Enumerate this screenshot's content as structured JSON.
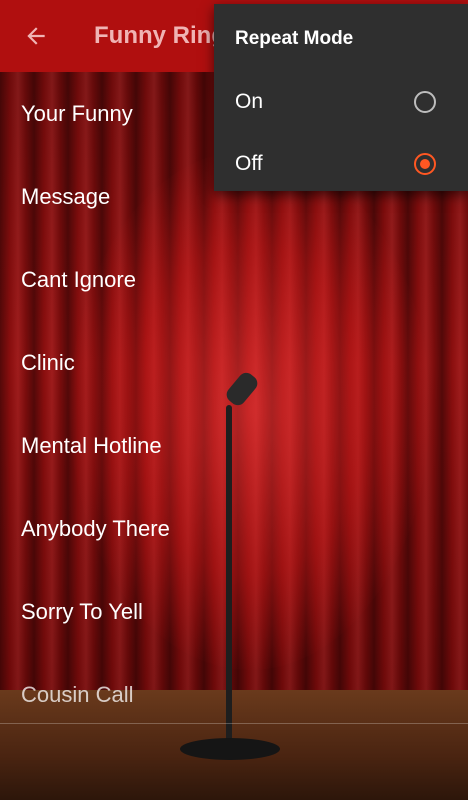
{
  "appbar": {
    "title": "Funny Ring",
    "back_icon": "arrow-left-icon"
  },
  "list": {
    "items": [
      {
        "label": "Your Funny"
      },
      {
        "label": "Message"
      },
      {
        "label": "Cant Ignore"
      },
      {
        "label": "Clinic"
      },
      {
        "label": "Mental Hotline"
      },
      {
        "label": "Anybody There"
      },
      {
        "label": "Sorry To Yell"
      },
      {
        "label": "Cousin Call"
      }
    ]
  },
  "menu": {
    "title": "Repeat Mode",
    "options": [
      {
        "label": "On",
        "selected": false
      },
      {
        "label": "Off",
        "selected": true
      }
    ],
    "accent": "#ff5722"
  },
  "colors": {
    "appbar": "#b00f0f",
    "menu_bg": "#2f2f2f"
  }
}
